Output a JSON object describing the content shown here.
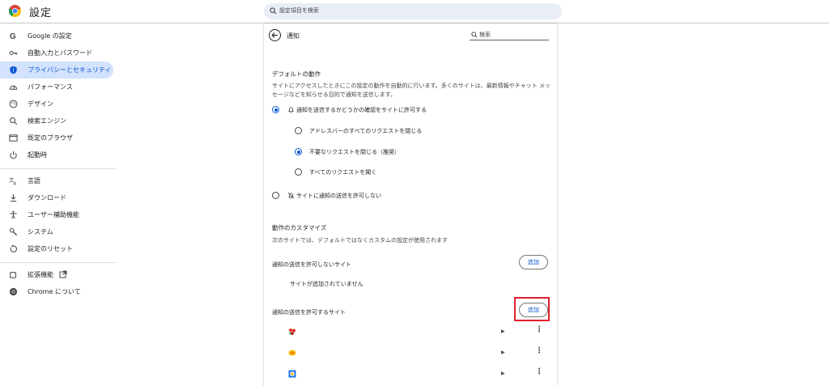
{
  "header": {
    "title": "設定",
    "search_placeholder": "設定項目を検索"
  },
  "sidebar": {
    "items": [
      {
        "label": "Google の設定",
        "icon": "google-icon"
      },
      {
        "label": "自動入力とパスワード",
        "icon": "key-icon"
      },
      {
        "label": "プライバシーとセキュリティ",
        "icon": "shield-icon"
      },
      {
        "label": "パフォーマンス",
        "icon": "speedometer-icon"
      },
      {
        "label": "デザイン",
        "icon": "palette-icon"
      },
      {
        "label": "検索エンジン",
        "icon": "search-icon"
      },
      {
        "label": "既定のブラウザ",
        "icon": "browser-window-icon"
      },
      {
        "label": "起動時",
        "icon": "power-icon"
      },
      {
        "label": "言語",
        "icon": "translate-icon"
      },
      {
        "label": "ダウンロード",
        "icon": "download-icon"
      },
      {
        "label": "ユーザー補助機能",
        "icon": "accessibility-icon"
      },
      {
        "label": "システム",
        "icon": "wrench-icon"
      },
      {
        "label": "設定のリセット",
        "icon": "reset-icon"
      },
      {
        "label": "拡張機能",
        "icon": "puzzle-icon"
      },
      {
        "label": "Chrome について",
        "icon": "chrome-icon"
      }
    ],
    "active_index": 2
  },
  "main": {
    "title": "通知",
    "search_placeholder": "検索",
    "default_behavior": {
      "heading": "デフォルトの動作",
      "description": "サイトにアクセスしたときにこの設定の動作を自動的に行います。多くのサイトは、最新情報やチャット メッセージなどを知らせる目的で通知を送信します。",
      "options": [
        {
          "label": "通知を送信するかどうかの確認をサイトに許可する",
          "checked": true,
          "icon": "bell-icon"
        },
        {
          "label": "アドレスバーのすべてのリクエストを閉じる",
          "checked": false
        },
        {
          "label": "不要なリクエストを閉じる（推奨）",
          "checked": true
        },
        {
          "label": "すべてのリクエストを聞く",
          "checked": false
        },
        {
          "label": "サイトに通知の送信を許可しない",
          "checked": false,
          "icon": "bell-off-icon"
        }
      ]
    },
    "custom_behavior": {
      "heading": "動作のカスタマイズ",
      "description": "次のサイトでは、デフォルトではなくカスタムの設定が使用されます",
      "blocked": {
        "label": "通知の送信を許可しないサイト",
        "add_label": "追加",
        "empty_message": "サイトが追加されていません"
      },
      "allowed": {
        "label": "通知の送信を許可するサイト",
        "add_label": "追加",
        "sites": [
          {
            "favicon": "red-flower-favicon"
          },
          {
            "favicon": "yellow-chat-favicon"
          },
          {
            "favicon": "blue-calendar-favicon"
          }
        ]
      }
    }
  },
  "colors": {
    "accent": "#0b57d0",
    "active_nav_bg": "#d3e3fd",
    "highlight": "#e0202a",
    "search_bg": "#e9eef6"
  }
}
